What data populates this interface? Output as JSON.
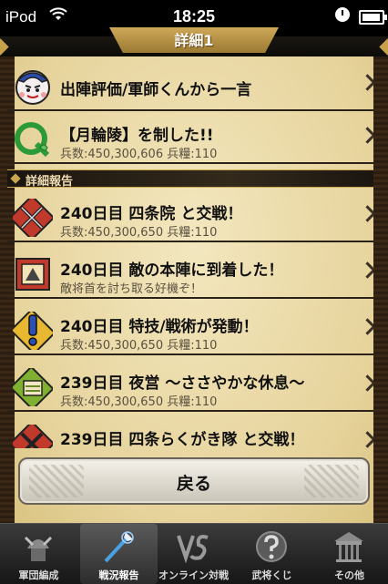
{
  "status_bar": {
    "carrier": "iPod",
    "time": "18:25"
  },
  "header": {
    "title": "詳細1"
  },
  "summary_rows": [
    {
      "title": "出陣評価/軍師くんから一言",
      "icon": "strategist-face-icon"
    },
    {
      "title": "【月輪陵】を制した!!",
      "sub": "兵数:450,300,606 兵糧:110",
      "icon": "q-seal-icon"
    }
  ],
  "section_header": "詳細報告",
  "report_rows": [
    {
      "title": "240日目 四条院 と交戦！",
      "sub": "兵数:450,300,650 兵糧:110",
      "icon": "crossed-swords-icon"
    },
    {
      "title": "240日目 敵の本陣に到着した！",
      "sub": "敵将首を討ち取る好機ぞ！",
      "icon": "enemy-camp-icon"
    },
    {
      "title": "240日目 特技/戦術が発動！",
      "sub": "兵数:450,300,650 兵糧:110",
      "icon": "exclamation-icon"
    },
    {
      "title": "239日目 夜営 ～ささやかな休息～",
      "sub": "兵数:450,300,650 兵糧:110",
      "icon": "rest-camp-icon"
    },
    {
      "title": "239日目 四条らくがき隊 と交戦！",
      "sub": "",
      "icon": "crossed-swords-icon"
    }
  ],
  "back_button": {
    "label": "戻る"
  },
  "tabs": [
    {
      "label": "軍団編成",
      "icon": "samurai-helmet-icon",
      "active": false
    },
    {
      "label": "戦況報告",
      "icon": "spear-icon",
      "active": true
    },
    {
      "label": "オンライン対戦",
      "icon": "versus-icon",
      "active": false
    },
    {
      "label": "武将くじ",
      "icon": "question-icon",
      "active": false
    },
    {
      "label": "その他",
      "icon": "shrine-icon",
      "active": false
    }
  ],
  "colors": {
    "parchment": "#ecdba8",
    "gold": "#c9a74e",
    "dark": "#1a1510"
  }
}
